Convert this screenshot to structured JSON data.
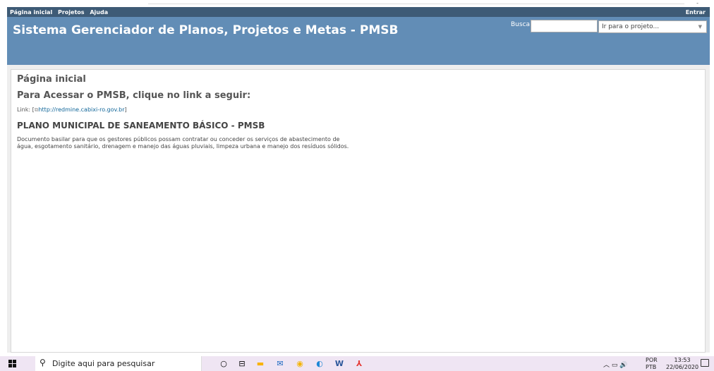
{
  "browser": {
    "corner_glyph": "-"
  },
  "top_menu": {
    "items": [
      "Página inicial",
      "Projetos",
      "Ajuda"
    ],
    "login": "Entrar"
  },
  "header": {
    "title": "Sistema Gerenciador de Planos, Projetos e Metas - PMSB",
    "search_label": "Busca:",
    "search_value": "",
    "jump_label": "Ir para o projeto..."
  },
  "content": {
    "page_title": "Página inicial",
    "access_heading": "Para Acessar o PMSB, clique no link a seguir:",
    "link_label": "Link: [",
    "link_url": "http://redmine.cabixi-ro.gov.br",
    "link_close": "]",
    "plan_title": "PLANO MUNICIPAL DE SANEAMENTO BÁSICO - PMSB",
    "description": "Documento basilar para que os gestores públicos possam contratar ou conceder os serviços de abastecimento de água, esgotamento sanitário, drenagem e manejo das águas pluviais, limpeza urbana e manejo dos resíduos sólidos."
  },
  "taskbar": {
    "search_placeholder": "Digite aqui para pesquisar",
    "lang_top": "POR",
    "lang_bottom": "PTB",
    "time": "13:53",
    "date": "22/06/2020",
    "colors": {
      "edge": "#1e88d6",
      "chrome": "#f4b400",
      "mail": "#1565c0",
      "word": "#2b579a",
      "acrobat": "#e53935",
      "files": "#f9b200"
    }
  }
}
